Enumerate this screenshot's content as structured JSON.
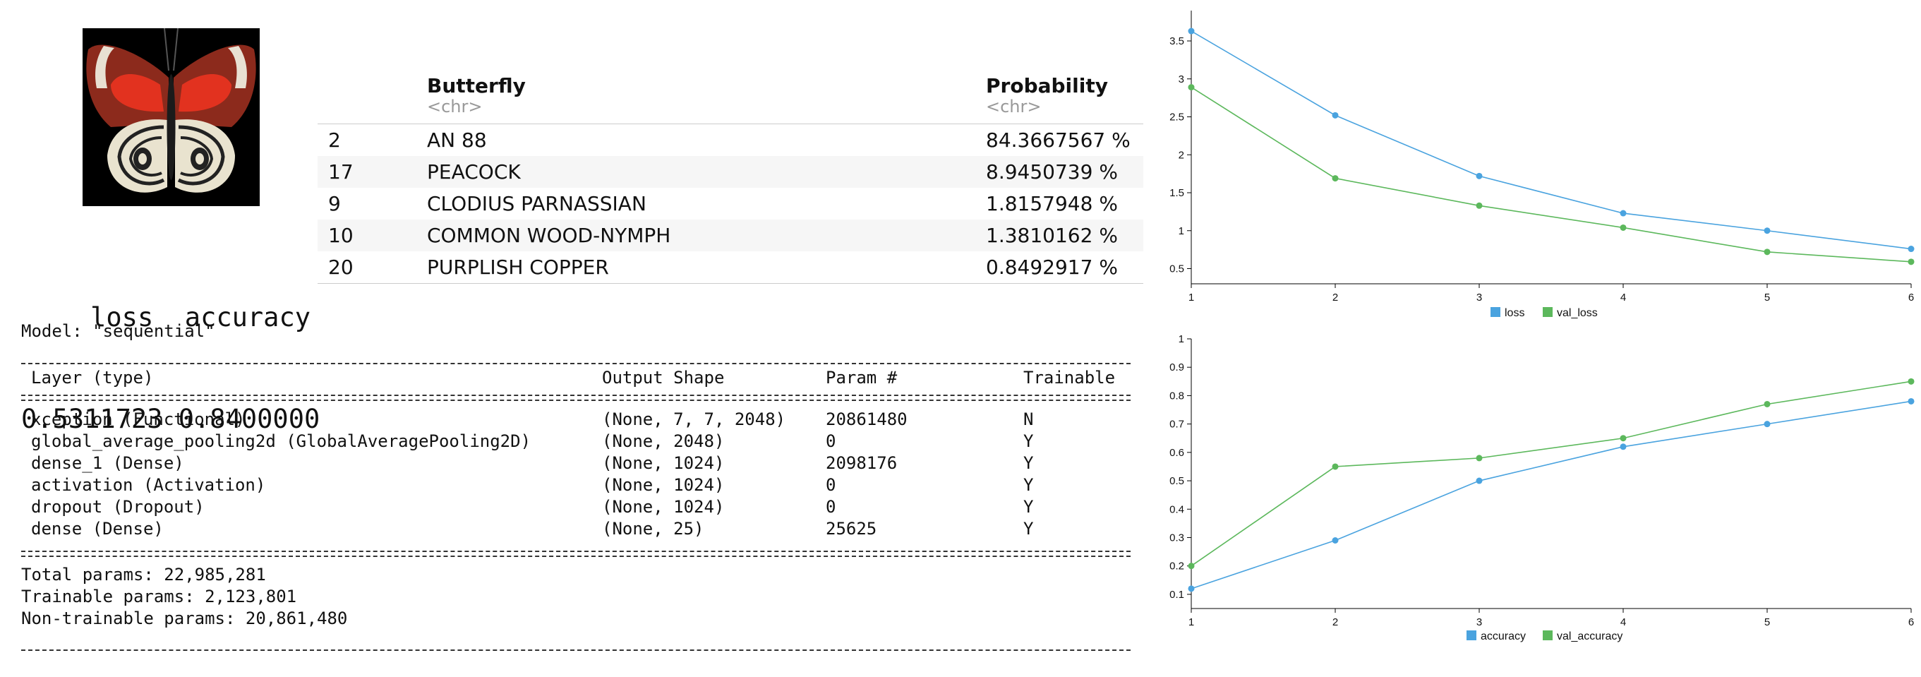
{
  "image": {
    "alt": "butterfly photo"
  },
  "metrics": {
    "header": "    loss  accuracy",
    "values": "0.5311723 0.8400000"
  },
  "predictions": {
    "columns": [
      {
        "name": "",
        "type": ""
      },
      {
        "name": "Butterfly",
        "type": "<chr>"
      },
      {
        "name": "Probability",
        "type": "<chr>"
      }
    ],
    "rows": [
      {
        "id": "2",
        "butterfly": "AN 88",
        "probability": "84.3667567 %"
      },
      {
        "id": "17",
        "butterfly": "PEACOCK",
        "probability": "8.9450739 %"
      },
      {
        "id": "9",
        "butterfly": "CLODIUS PARNASSIAN",
        "probability": "1.8157948 %"
      },
      {
        "id": "10",
        "butterfly": "COMMON WOOD-NYMPH",
        "probability": "1.3810162 %"
      },
      {
        "id": "20",
        "butterfly": "PURPLISH COPPER",
        "probability": "0.8492917 %"
      }
    ]
  },
  "model": {
    "title": "Model: \"sequential\"",
    "columns": [
      "Layer (type)",
      "Output Shape",
      "Param #",
      "Trainable"
    ],
    "layers": [
      {
        "layer": "xception (Functional)",
        "shape": "(None, 7, 7, 2048)",
        "params": "20861480",
        "trainable": "N"
      },
      {
        "layer": "global_average_pooling2d (GlobalAveragePooling2D)",
        "shape": "(None, 2048)",
        "params": "0",
        "trainable": "Y"
      },
      {
        "layer": "dense_1 (Dense)",
        "shape": "(None, 1024)",
        "params": "2098176",
        "trainable": "Y"
      },
      {
        "layer": "activation (Activation)",
        "shape": "(None, 1024)",
        "params": "0",
        "trainable": "Y"
      },
      {
        "layer": "dropout (Dropout)",
        "shape": "(None, 1024)",
        "params": "0",
        "trainable": "Y"
      },
      {
        "layer": "dense (Dense)",
        "shape": "(None, 25)",
        "params": "25625",
        "trainable": "Y"
      }
    ],
    "total": "Total params: 22,985,281",
    "trainable": "Trainable params: 2,123,801",
    "non_trainable": "Non-trainable params: 20,861,480"
  },
  "colors": {
    "series_a": "#4aa3df",
    "series_b": "#5cb85c"
  },
  "chart_data": [
    {
      "type": "line",
      "x": [
        1,
        2,
        3,
        4,
        5,
        6
      ],
      "xticks": [
        "1",
        "2",
        "3",
        "4",
        "5",
        "6"
      ],
      "ylim": [
        0.3,
        3.9
      ],
      "yticks": [
        0.5,
        1,
        1.5,
        2,
        2.5,
        3,
        3.5
      ],
      "ytick_labels": [
        "0.5",
        "1",
        "1.5",
        "2",
        "2.5",
        "3",
        "3.5"
      ],
      "series": [
        {
          "name": "loss",
          "color": "#4aa3df",
          "values": [
            3.63,
            2.52,
            1.72,
            1.23,
            1.0,
            0.76
          ]
        },
        {
          "name": "val_loss",
          "color": "#5cb85c",
          "values": [
            2.89,
            1.69,
            1.33,
            1.04,
            0.72,
            0.59
          ]
        }
      ],
      "legend": "bottom-center"
    },
    {
      "type": "line",
      "x": [
        1,
        2,
        3,
        4,
        5,
        6
      ],
      "xticks": [
        "1",
        "2",
        "3",
        "4",
        "5",
        "6"
      ],
      "ylim": [
        0.05,
        1.0
      ],
      "yticks": [
        0.1,
        0.2,
        0.3,
        0.4,
        0.5,
        0.6,
        0.7,
        0.8,
        0.9,
        1
      ],
      "ytick_labels": [
        "0.1",
        "0.2",
        "0.3",
        "0.4",
        "0.5",
        "0.6",
        "0.7",
        "0.8",
        "0.9",
        "1"
      ],
      "series": [
        {
          "name": "accuracy",
          "color": "#4aa3df",
          "values": [
            0.12,
            0.29,
            0.5,
            0.62,
            0.7,
            0.78
          ]
        },
        {
          "name": "val_accuracy",
          "color": "#5cb85c",
          "values": [
            0.2,
            0.55,
            0.58,
            0.65,
            0.77,
            0.85
          ]
        }
      ],
      "legend": "bottom-center"
    }
  ]
}
